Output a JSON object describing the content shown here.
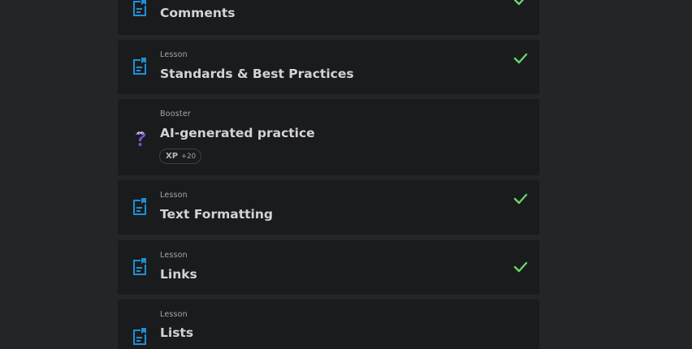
{
  "items": [
    {
      "kind": "",
      "title": "Comments",
      "completed": true,
      "icon": "lesson-document-icon"
    },
    {
      "kind": "Lesson",
      "title": "Standards & Best Practices",
      "completed": true,
      "icon": "lesson-document-icon"
    },
    {
      "kind": "Booster",
      "title": "AI-generated practice",
      "completed": false,
      "icon": "question-mark-mascot-icon",
      "xp_label": "XP",
      "xp_value": "+20"
    },
    {
      "kind": "Lesson",
      "title": "Text Formatting",
      "completed": true,
      "icon": "lesson-document-icon"
    },
    {
      "kind": "Lesson",
      "title": "Links",
      "completed": true,
      "icon": "lesson-document-icon"
    },
    {
      "kind": "Lesson",
      "title": "Lists",
      "completed": false,
      "icon": "lesson-document-icon"
    }
  ],
  "colors": {
    "page_background": "#242526",
    "card_background": "#1a1b1d",
    "lesson_icon": "#1f8fd6",
    "booster_icon": "#7b4fd8",
    "check": "#6bd36b"
  }
}
